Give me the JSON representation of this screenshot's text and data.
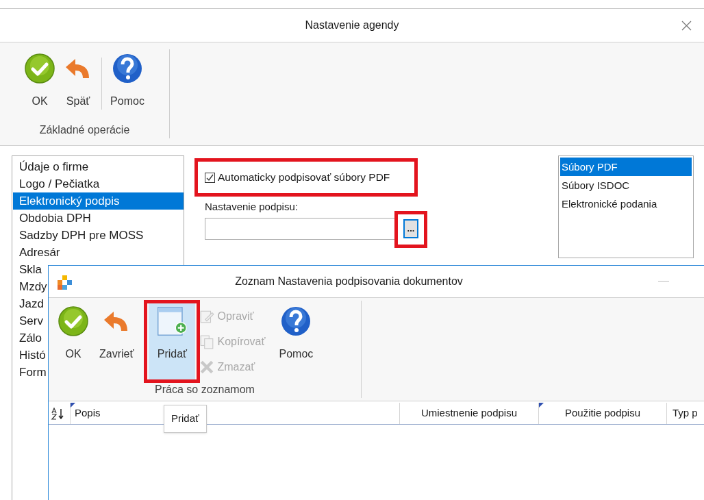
{
  "window": {
    "title": "Nastavenie agendy"
  },
  "toolbar": {
    "buttons": [
      {
        "label": "OK",
        "kind": "ok"
      },
      {
        "label": "Späť",
        "kind": "back"
      },
      {
        "label": "Pomoc",
        "kind": "help"
      }
    ],
    "group": "Základné operácie"
  },
  "sections": [
    {
      "label": "Údaje o firme",
      "selected": false
    },
    {
      "label": "Logo / Pečiatka",
      "selected": false
    },
    {
      "label": "Elektronický podpis",
      "selected": true
    },
    {
      "label": "Obdobia DPH",
      "selected": false
    },
    {
      "label": "Sadzby DPH pre MOSS",
      "selected": false
    },
    {
      "label": "Adresár",
      "selected": false
    },
    {
      "label": "Skla",
      "selected": false
    },
    {
      "label": "Mzdy",
      "selected": false
    },
    {
      "label": "Jazd",
      "selected": false
    },
    {
      "label": "Serv",
      "selected": false
    },
    {
      "label": "Zálo",
      "selected": false
    },
    {
      "label": "Histó",
      "selected": false
    },
    {
      "label": "Form",
      "selected": false
    }
  ],
  "auto_sign": {
    "label": "Automaticky podpisovať súbory PDF",
    "checked": true,
    "highlighted": true
  },
  "signature_setting": {
    "label": "Nastavenie podpisu:",
    "browse": {
      "label": "...",
      "highlighted": true
    }
  },
  "file_types": [
    {
      "label": "Súbory PDF",
      "selected": true
    },
    {
      "label": "Súbory ISDOC",
      "selected": false
    },
    {
      "label": "Elektronické podania",
      "selected": false
    }
  ],
  "list_window": {
    "title": "Zoznam Nastavenia podpisovania dokumentov",
    "toolbar": {
      "buttons": [
        {
          "kind": "ok",
          "label": "OK"
        },
        {
          "kind": "back",
          "label": "Zavrieť"
        },
        {
          "kind": "add",
          "label": "Pridať",
          "hovered": true,
          "highlighted": true
        },
        {
          "kind": "edit",
          "label": "Opraviť",
          "disabled": true
        },
        {
          "kind": "copy",
          "label": "Kopírovať",
          "disabled": true
        },
        {
          "kind": "delete",
          "label": "Zmazať",
          "disabled": true
        },
        {
          "kind": "help",
          "label": "Pomoc"
        }
      ],
      "group": "Práca so zoznamom"
    },
    "columns": [
      {
        "label": "Popis",
        "marked": true
      },
      {
        "label": "Umiestnenie podpisu",
        "marked": false
      },
      {
        "label": "Použitie podpisu",
        "marked": true
      },
      {
        "label": "Typ p",
        "marked": false
      }
    ],
    "tooltip": "Pridať"
  }
}
